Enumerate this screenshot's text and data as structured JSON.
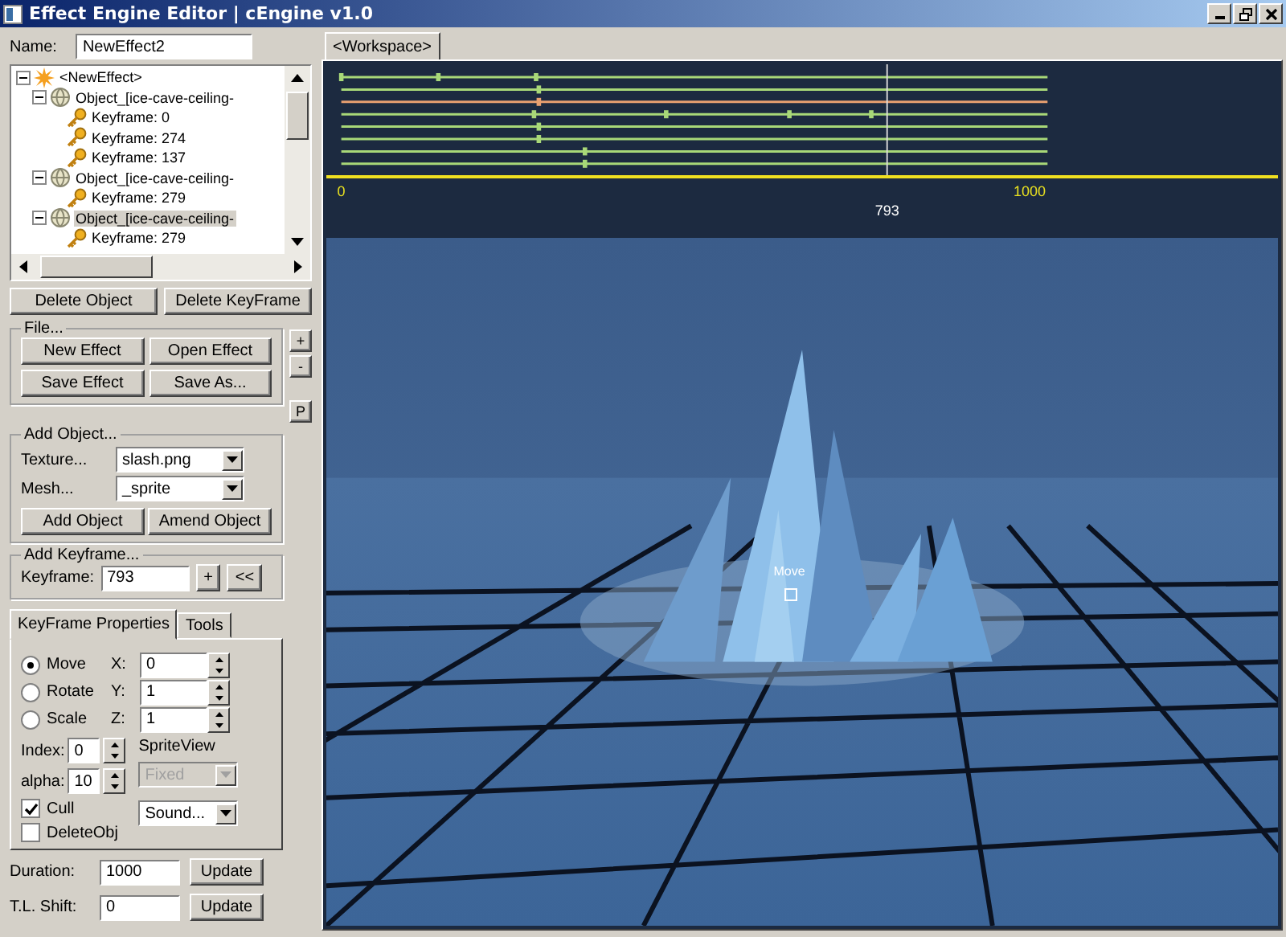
{
  "window": {
    "title": "Effect Engine Editor | cEngine v1.0"
  },
  "name_field": {
    "label": "Name:",
    "value": "NewEffect2"
  },
  "tree": {
    "items": [
      {
        "label": "<NewEffect>",
        "kind": "effect",
        "selected": false,
        "expanded": true,
        "children": [
          {
            "label": "Object_[ice-cave-ceiling-",
            "kind": "object",
            "selected": false,
            "expanded": true,
            "children": [
              {
                "label": "Keyframe: 0",
                "kind": "keyframe",
                "selected": false
              },
              {
                "label": "Keyframe: 274",
                "kind": "keyframe",
                "selected": false
              },
              {
                "label": "Keyframe: 137",
                "kind": "keyframe",
                "selected": false
              }
            ]
          },
          {
            "label": "Object_[ice-cave-ceiling-",
            "kind": "object",
            "selected": false,
            "expanded": true,
            "children": [
              {
                "label": "Keyframe: 279",
                "kind": "keyframe",
                "selected": false
              }
            ]
          },
          {
            "label": "Object_[ice-cave-ceiling-",
            "kind": "object",
            "selected": true,
            "expanded": true,
            "children": [
              {
                "label": "Keyframe: 279",
                "kind": "keyframe",
                "selected": false
              }
            ]
          }
        ]
      }
    ]
  },
  "object_buttons": [
    "Delete Object",
    "Delete KeyFrame"
  ],
  "file_group": {
    "title": "File...",
    "buttons": [
      "New Effect",
      "Open Effect",
      "Save Effect",
      "Save As..."
    ]
  },
  "side_buttons": [
    "+",
    "-",
    "P"
  ],
  "add_object": {
    "title": "Add Object...",
    "texture": {
      "label": "Texture...",
      "value": "slash.png"
    },
    "mesh": {
      "label": "Mesh...",
      "value": "_sprite"
    },
    "buttons": [
      "Add Object",
      "Amend Object"
    ]
  },
  "add_keyframe": {
    "title": "Add Keyframe...",
    "label": "Keyframe:",
    "value": "793",
    "buttons": [
      "+",
      "<<"
    ]
  },
  "tabs": [
    {
      "label": "KeyFrame Properties",
      "selected": true
    },
    {
      "label": "Tools",
      "selected": false
    }
  ],
  "transform": [
    {
      "label": "Move",
      "selected": true,
      "axis": "X:",
      "value": "0"
    },
    {
      "label": "Rotate",
      "selected": false,
      "axis": "Y:",
      "value": "1"
    },
    {
      "label": "Scale",
      "selected": false,
      "axis": "Z:",
      "value": "1"
    }
  ],
  "index": {
    "label": "Index:",
    "value": "0"
  },
  "alpha": {
    "label": "alpha:",
    "value": "10"
  },
  "sprite_view": {
    "label": "SpriteView",
    "value": "Fixed",
    "disabled": true
  },
  "sound": {
    "value": "Sound...",
    "disabled": false
  },
  "checkboxes": [
    {
      "label": "Cull",
      "checked": true
    },
    {
      "label": "DeleteObj",
      "checked": false
    }
  ],
  "duration": {
    "label": "Duration:",
    "value": "1000",
    "button": "Update"
  },
  "tl_shift": {
    "label": "T.L. Shift:",
    "value": "0",
    "button": "Update"
  },
  "workspace_tab": {
    "label": "<Workspace>",
    "selected": true
  },
  "timeline": {
    "tick_labels": [
      "0",
      "1000"
    ],
    "cursor_label": "793",
    "tracks": [
      {
        "selected": false
      },
      {
        "selected": false
      },
      {
        "selected": true
      },
      {
        "selected": false
      },
      {
        "selected": false
      },
      {
        "selected": false
      },
      {
        "selected": false
      },
      {
        "selected": false
      }
    ]
  },
  "viewport": {
    "gizmo_label": "Move"
  }
}
